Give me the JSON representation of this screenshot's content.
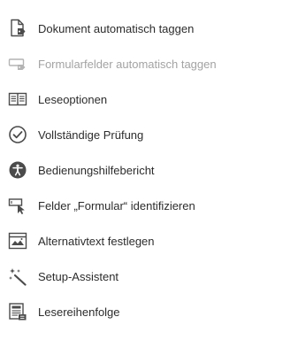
{
  "menu": {
    "items": [
      {
        "label": "Dokument automatisch taggen",
        "icon": "document-tag-icon",
        "enabled": true
      },
      {
        "label": "Formularfelder automatisch taggen",
        "icon": "form-field-tag-icon",
        "enabled": false
      },
      {
        "label": "Leseoptionen",
        "icon": "book-reading-icon",
        "enabled": true
      },
      {
        "label": "Vollständige Prüfung",
        "icon": "check-circle-icon",
        "enabled": true
      },
      {
        "label": "Bedienungshilfebericht",
        "icon": "accessibility-person-icon",
        "enabled": true
      },
      {
        "label": "Felder „Formular“ identifizieren",
        "icon": "form-cursor-icon",
        "enabled": true
      },
      {
        "label": "Alternativtext festlegen",
        "icon": "image-alt-text-icon",
        "enabled": true
      },
      {
        "label": "Setup-Assistent",
        "icon": "magic-wand-icon",
        "enabled": true
      },
      {
        "label": "Lesereihenfolge",
        "icon": "reading-order-icon",
        "enabled": true
      }
    ]
  }
}
